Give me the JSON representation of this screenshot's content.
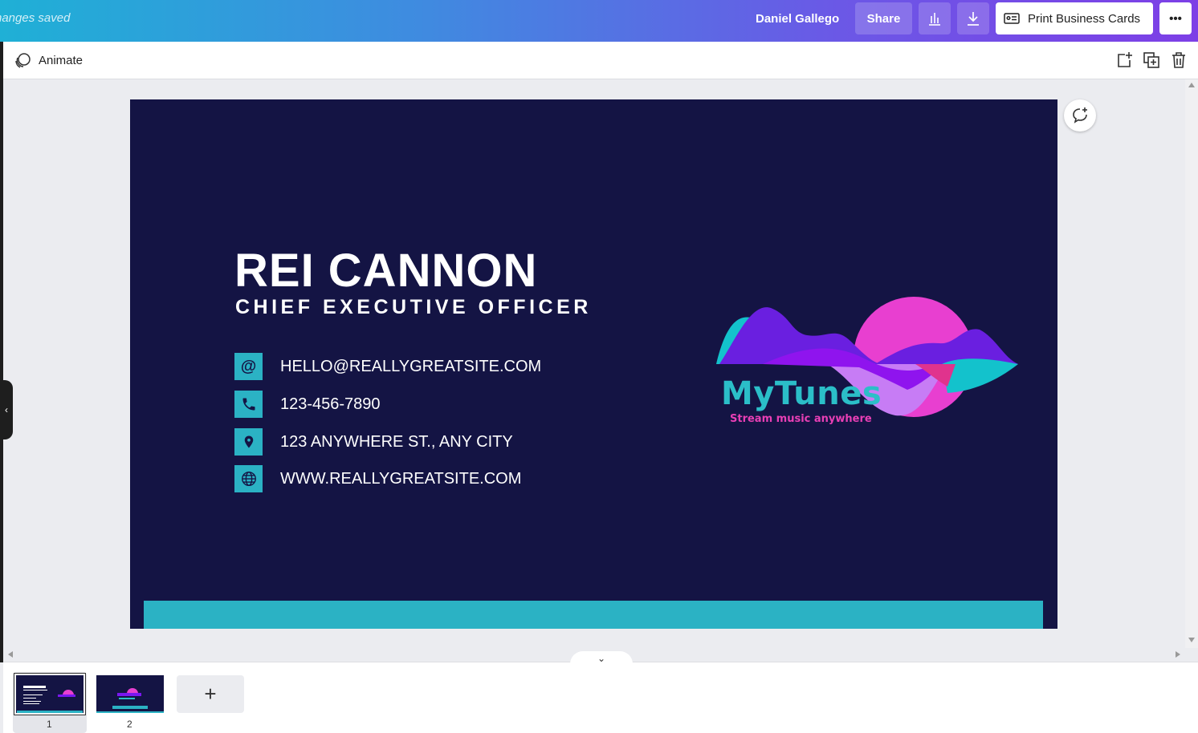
{
  "topbar": {
    "saved_status": "hanges saved",
    "user_name": "Daniel Gallego",
    "share_label": "Share",
    "print_label": "Print Business Cards",
    "more_label": "•••"
  },
  "toolbar": {
    "animate_label": "Animate"
  },
  "card": {
    "name": "REI CANNON",
    "title": "CHIEF EXECUTIVE OFFICER",
    "email_icon": "@",
    "email": "HELLO@REALLYGREATSITE.COM",
    "phone": "123-456-7890",
    "address": "123 ANYWHERE ST., ANY CITY",
    "website": "WWW.REALLYGREATSITE.COM",
    "logo_name": "MyTunes",
    "logo_tagline": "Stream music anywhere",
    "colors": {
      "background": "#141444",
      "accent": "#2bb2c4",
      "logo_pink": "#e83fd0",
      "logo_purple": "#7a17f0"
    }
  },
  "pages": {
    "labels": [
      "1",
      "2"
    ],
    "add_label": "+",
    "collapse_label": "⌄"
  },
  "left_handle_label": "‹"
}
